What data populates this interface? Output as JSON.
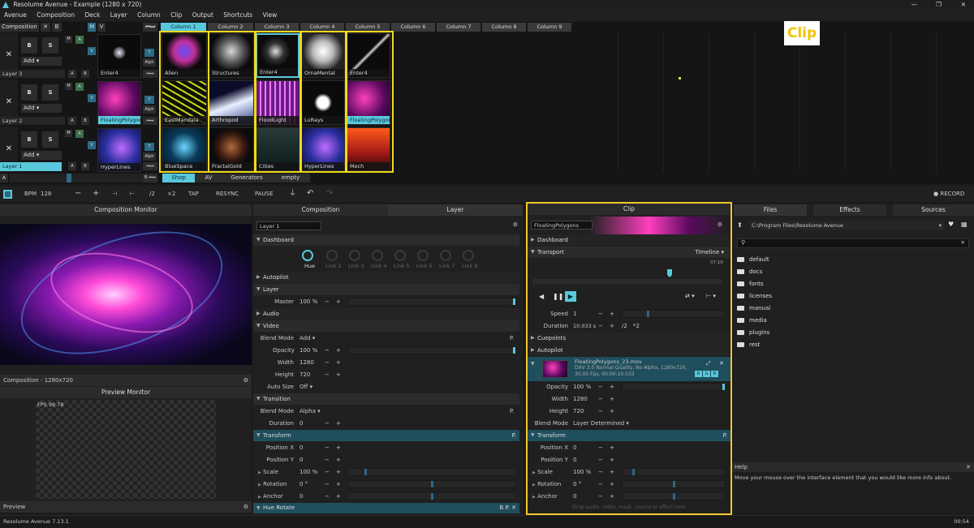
{
  "window": {
    "title": "Resolume Avenue - Example (1280 x 720)",
    "min": "—",
    "max": "❐",
    "close": "✕"
  },
  "menu": [
    "Avenue",
    "Composition",
    "Deck",
    "Layer",
    "Column",
    "Clip",
    "Output",
    "Shortcuts",
    "View"
  ],
  "composition": {
    "label": "Composition",
    "x": "✕",
    "b": "B"
  },
  "columns": [
    "Column 1",
    "Column 2",
    "Column 3",
    "Column 4",
    "Column 5",
    "Column 6",
    "Column 7",
    "Column 8",
    "Column 9"
  ],
  "layers": [
    {
      "name": "Layer 3",
      "add": "Add",
      "b": "B",
      "s": "S",
      "m": "M",
      "a": "A",
      "v": "V",
      "t": "T",
      "alph": "Alph",
      "preview": "Enter4",
      "clips": [
        "Alien",
        "Structures",
        "Enter4",
        "OrnaMental",
        "Enter4"
      ]
    },
    {
      "name": "Layer 2",
      "add": "Add",
      "b": "B",
      "s": "S",
      "m": "M",
      "a": "A",
      "v": "V",
      "t": "T",
      "alph": "Alph",
      "preview": "FloatingPolygons",
      "clips": [
        "EastMandala",
        "Arthropod",
        "FloodLight",
        "LuRays",
        "FloatingPolygons"
      ]
    },
    {
      "name": "Layer 1",
      "add": "Add",
      "b": "B",
      "s": "S",
      "m": "M",
      "a": "A",
      "v": "V",
      "t": "T",
      "alph": "Alph",
      "preview": "HyperLines",
      "clips": [
        "BlueSpace",
        "FractalGold",
        "Cities",
        "HyperLines",
        "Mech"
      ]
    }
  ],
  "deck_tabs": [
    "Shop",
    "AV",
    "Generators",
    "empty"
  ],
  "annotation": "Clip",
  "transport": {
    "bpm_label": "BPM",
    "bpm": "128",
    "minus": "−",
    "plus": "+",
    "bar1": "⊣",
    "bar2": "⊢",
    "half": "/2",
    "double": "×2",
    "tap": "TAP",
    "resync": "RESYNC",
    "pause": "PAUSE",
    "record": "● RECORD"
  },
  "comp_monitor": {
    "title": "Composition Monitor",
    "footer": "Composition - 1280x720"
  },
  "preview_monitor": {
    "title": "Preview Monitor",
    "fps": "FPS 99.78",
    "footer": "Preview"
  },
  "layer_panel": {
    "tabs": [
      "Composition",
      "Layer"
    ],
    "name": "Layer 1",
    "dashboard": "Dashboard",
    "knobs": [
      "Hue",
      "Link 2",
      "Link 3",
      "Link 4",
      "Link 5",
      "Link 6",
      "Link 7",
      "Link 8"
    ],
    "sections": {
      "autopilot": "Autopilot",
      "layer": "Layer",
      "audio": "Audio",
      "video": "Video",
      "transition": "Transition",
      "transform": "Transform",
      "hue": "Hue Rotate"
    },
    "master": {
      "label": "Master",
      "value": "100 %"
    },
    "blend": {
      "label": "Blend Mode",
      "value": "Add"
    },
    "opacity": {
      "label": "Opacity",
      "value": "100 %"
    },
    "width": {
      "label": "Width",
      "value": "1280"
    },
    "height": {
      "label": "Height",
      "value": "720"
    },
    "autosize": {
      "label": "Auto Size",
      "value": "Off"
    },
    "tblend": {
      "label": "Blend Mode",
      "value": "Alpha"
    },
    "tdur": {
      "label": "Duration",
      "value": "0"
    },
    "posx": {
      "label": "Position X",
      "value": "0"
    },
    "posy": {
      "label": "Position Y",
      "value": "0"
    },
    "scale": {
      "label": "Scale",
      "value": "100 %"
    },
    "rotation": {
      "label": "Rotation",
      "value": "0 °"
    },
    "anchor": {
      "label": "Anchor",
      "value": "0"
    }
  },
  "clip_panel": {
    "title": "Clip",
    "name": "FloatingPolygons",
    "dashboard": "Dashboard",
    "transport": "Transport",
    "timeline": "Timeline",
    "time": "07.10",
    "speed": {
      "label": "Speed",
      "value": "1"
    },
    "duration": {
      "label": "Duration",
      "value": "10.033 s",
      "half": "/2",
      "double": "*2"
    },
    "cuepoints": "Cuepoints",
    "autopilot": "Autopilot",
    "file": "FloatingPolygons_23.mov",
    "codec": "DXV 3.0 Normal Quality, No Alpha, 1280x720,",
    "fps": "30.00 Fps, 00:00:10.033",
    "rgb": [
      "R",
      "G",
      "B"
    ],
    "opacity": {
      "label": "Opacity",
      "value": "100 %"
    },
    "width": {
      "label": "Width",
      "value": "1280"
    },
    "height": {
      "label": "Height",
      "value": "720"
    },
    "blend": {
      "label": "Blend Mode",
      "value": "Layer Determined"
    },
    "transform": "Transform",
    "posx": {
      "label": "Position X",
      "value": "0"
    },
    "posy": {
      "label": "Position Y",
      "value": "0"
    },
    "scale": {
      "label": "Scale",
      "value": "100 %"
    },
    "rotation": {
      "label": "Rotation",
      "value": "0 °"
    },
    "anchor": {
      "label": "Anchor",
      "value": "0"
    },
    "drop": "Drop audio, video, mask, source or effect here"
  },
  "browser": {
    "tabs": [
      "Files",
      "Effects",
      "Sources"
    ],
    "path": "C:\\Program Files\\Resolume Avenue",
    "folders": [
      "default",
      "docs",
      "fonts",
      "licenses",
      "manual",
      "media",
      "plugins",
      "rest"
    ]
  },
  "help": {
    "title": "Help",
    "text": "Move your mouse over the interface element that you would like more info about."
  },
  "status": {
    "version": "Resolume Avenue 7.13.1",
    "time": "00:54"
  }
}
